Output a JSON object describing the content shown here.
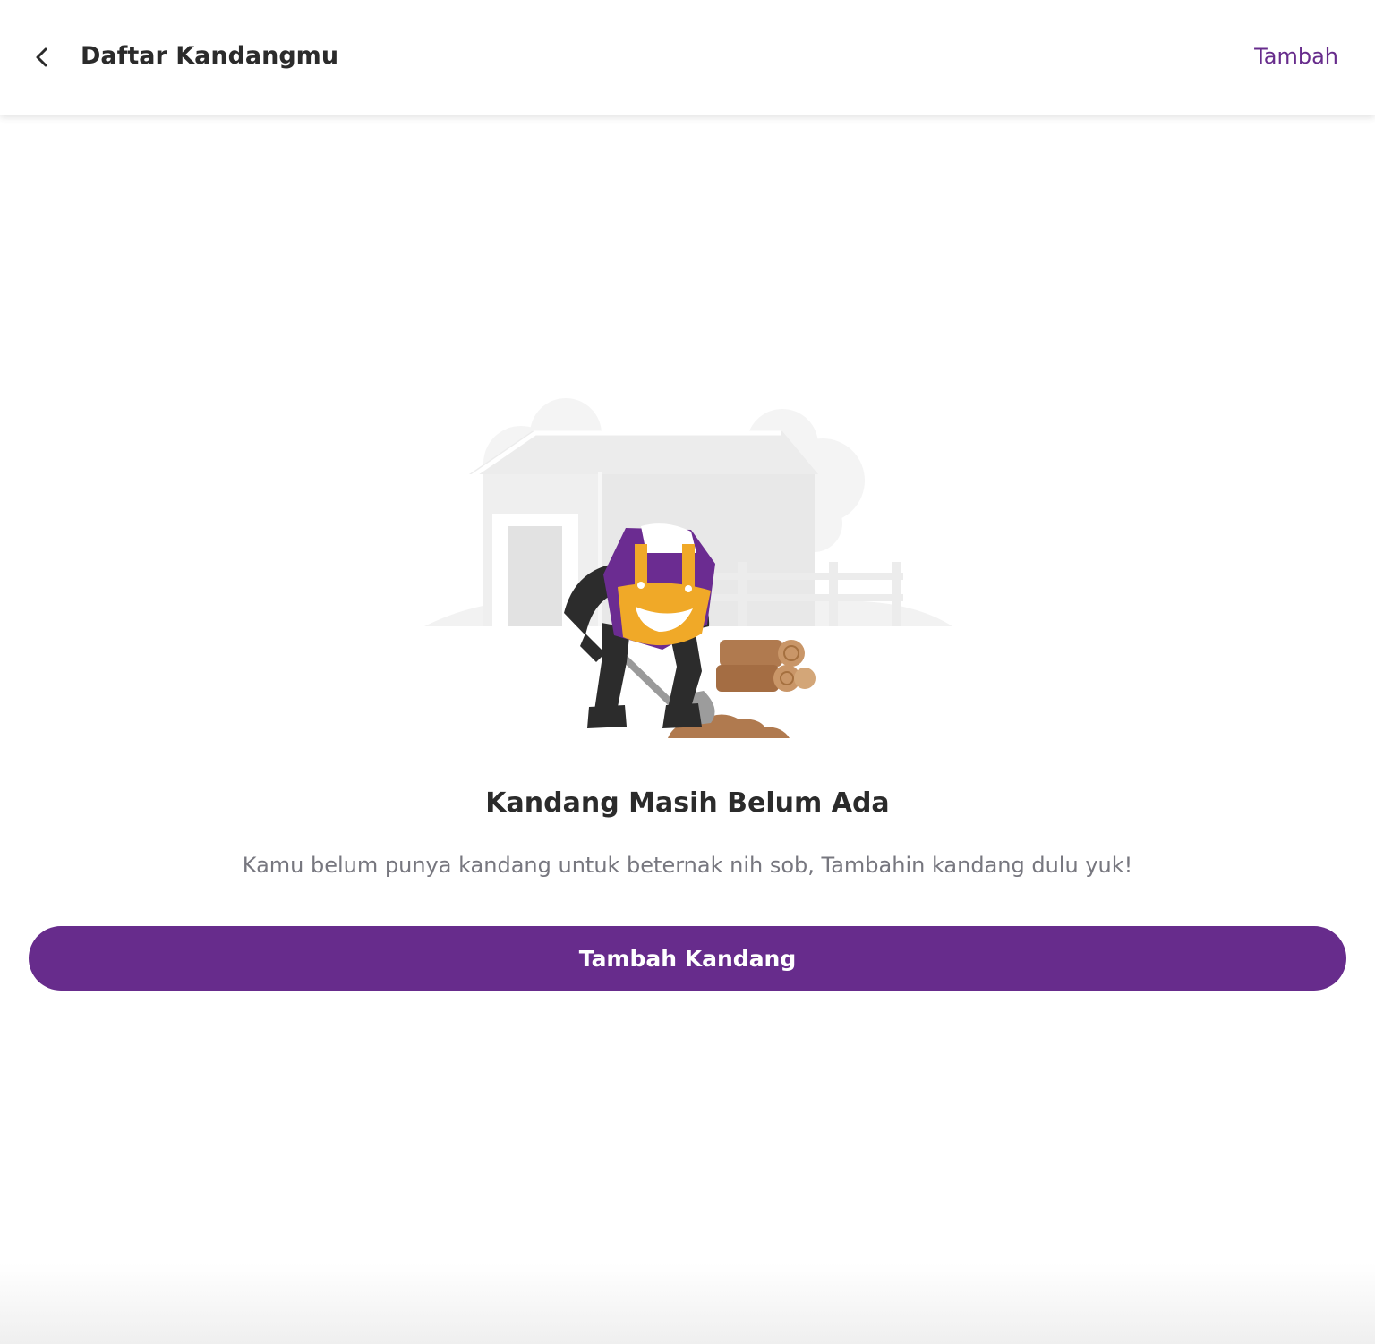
{
  "header": {
    "title": "Daftar Kandangmu",
    "action_label": "Tambah",
    "back_icon": "chevron-left-icon"
  },
  "empty_state": {
    "title": "Kandang Masih Belum Ada",
    "description": "Kamu belum punya kandang untuk beternak nih sob, Tambahin kandang dulu yuk!",
    "illustration": "farmer-digging-near-barn"
  },
  "primary_button": {
    "label": "Tambah Kandang"
  },
  "colors": {
    "brand": "#672c8c",
    "text_primary": "#2b2b2b",
    "text_secondary": "#77777f",
    "accent_yellow": "#f0a928",
    "wood": "#b07a4f"
  }
}
